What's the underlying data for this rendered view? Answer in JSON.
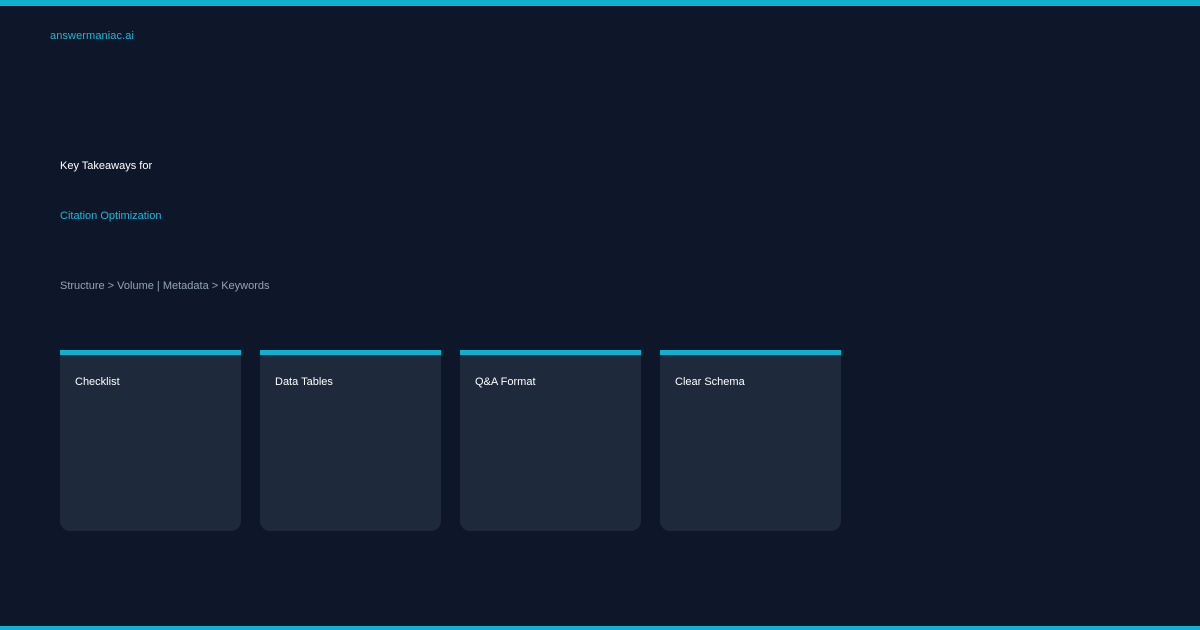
{
  "brand": {
    "name": "answermaniac.ai"
  },
  "hero": {
    "title": "Key Takeaways for",
    "title_accent": "Citation Optimization",
    "subtitle": "Structure > Volume | Metadata > Keywords"
  },
  "cards": [
    {
      "label": "Checklist"
    },
    {
      "label": "Data Tables"
    },
    {
      "label": "Q&A Format"
    },
    {
      "label": "Clear Schema"
    }
  ],
  "colors": {
    "background": "#0e1729",
    "accent": "#0fb1cf",
    "card": "#1e293b",
    "muted_text": "#94a3b8"
  }
}
